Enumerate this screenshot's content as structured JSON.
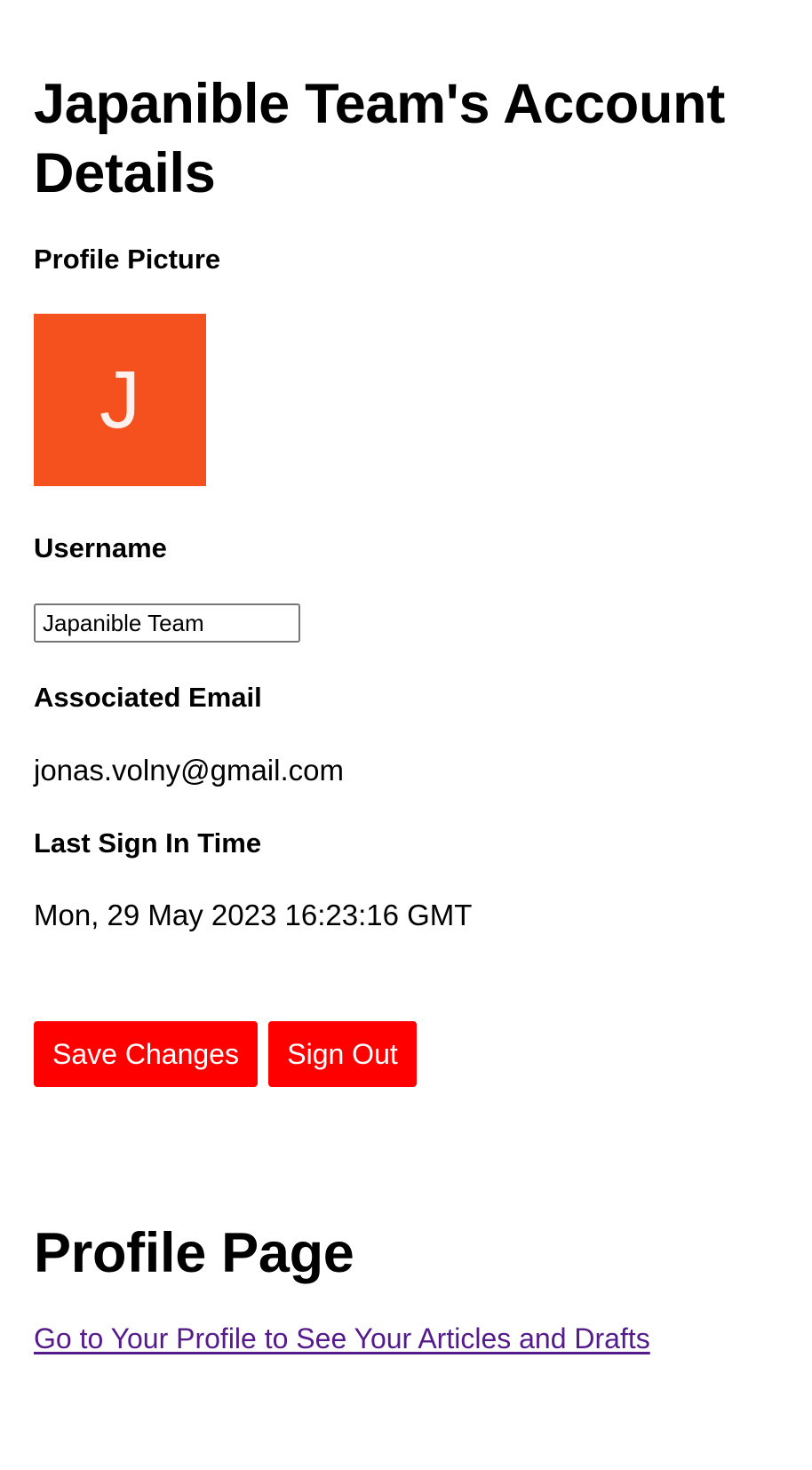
{
  "account": {
    "title": "Japanible Team's Account Details",
    "profile_picture_label": "Profile Picture",
    "avatar_letter": "J",
    "avatar_color": "#f4511e",
    "username_label": "Username",
    "username_value": "Japanible Team",
    "email_label": "Associated Email",
    "email_value": "jonas.volny@gmail.com",
    "last_signin_label": "Last Sign In Time",
    "last_signin_value": "Mon, 29 May 2023 16:23:16 GMT"
  },
  "actions": {
    "save_label": "Save Changes",
    "signout_label": "Sign Out",
    "button_color": "#ff0000"
  },
  "profile": {
    "heading": "Profile Page",
    "link_text": "Go to Your Profile to See Your Articles and Drafts",
    "link_color": "#551a8b"
  }
}
